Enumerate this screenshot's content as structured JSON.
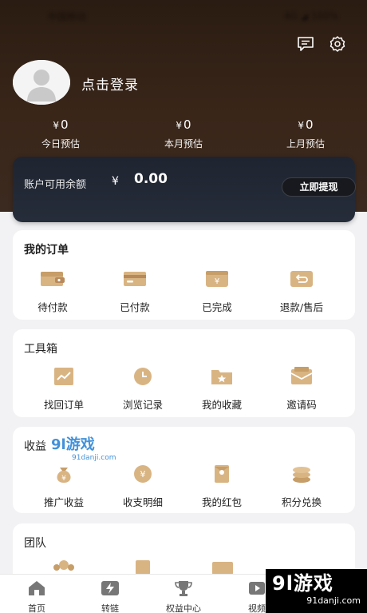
{
  "status_bar": {
    "left": "中国移动",
    "right": "4G ◢ 100%"
  },
  "header": {
    "message_icon": "message-icon",
    "settings_icon": "gear-icon"
  },
  "user": {
    "login_text": "点击登录"
  },
  "stats": [
    {
      "currency": "¥",
      "value": "0",
      "label": "今日预估"
    },
    {
      "currency": "¥",
      "value": "0",
      "label": "本月预估"
    },
    {
      "currency": "¥",
      "value": "0",
      "label": "上月预估"
    }
  ],
  "balance": {
    "label": "账户可用余额",
    "currency": "¥",
    "value": "0.00",
    "button": "立即提现"
  },
  "orders": {
    "title": "我的订单",
    "items": [
      {
        "label": "待付款",
        "icon": "wallet-icon"
      },
      {
        "label": "已付款",
        "icon": "card-icon"
      },
      {
        "label": "已完成",
        "icon": "yuan-card-icon"
      },
      {
        "label": "退款/售后",
        "icon": "refund-icon"
      }
    ]
  },
  "toolbox": {
    "title": "工具箱",
    "items": [
      {
        "label": "找回订单",
        "icon": "chart-icon"
      },
      {
        "label": "浏览记录",
        "icon": "clock-icon"
      },
      {
        "label": "我的收藏",
        "icon": "folder-star-icon"
      },
      {
        "label": "邀请码",
        "icon": "envelope-icon"
      }
    ]
  },
  "earnings": {
    "title": "收益",
    "items": [
      {
        "label": "推广收益",
        "icon": "money-bag-icon"
      },
      {
        "label": "收支明细",
        "icon": "yuan-coin-icon"
      },
      {
        "label": "我的红包",
        "icon": "red-packet-icon"
      },
      {
        "label": "积分兑换",
        "icon": "coins-stack-icon"
      }
    ]
  },
  "team": {
    "title": "团队"
  },
  "tabbar": [
    {
      "label": "首页",
      "icon": "home-icon"
    },
    {
      "label": "转链",
      "icon": "lightning-icon"
    },
    {
      "label": "权益中心",
      "icon": "trophy-icon"
    },
    {
      "label": "视频",
      "icon": "video-icon"
    }
  ],
  "watermark": {
    "brand": "9l游戏",
    "site": "91danji.com"
  },
  "colors": {
    "gold": "#c9a06a",
    "hero_dark": "#2a1c12",
    "card_dark": "#1e2430"
  }
}
